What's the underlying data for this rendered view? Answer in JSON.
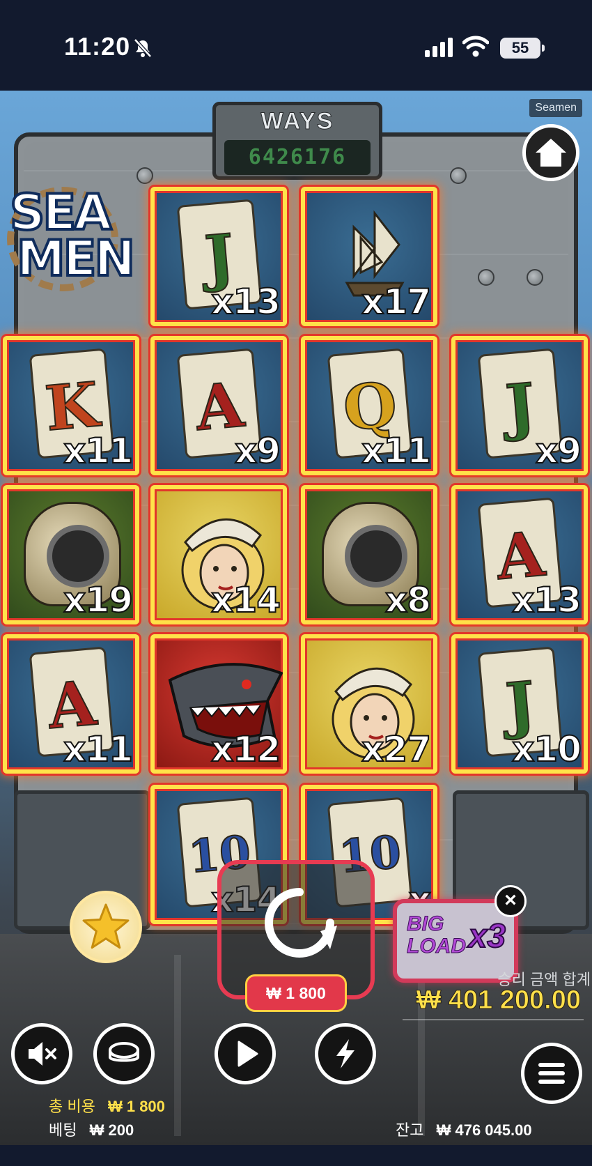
{
  "status_bar": {
    "time": "11:20",
    "battery": "55"
  },
  "game": {
    "name_label": "Seamen",
    "logo": {
      "line1": "SEA",
      "line2": "MEN"
    },
    "ways": {
      "label": "WAYS",
      "value": "6426176"
    }
  },
  "reels": [
    {
      "symbol": "J",
      "color": "#2f6b2a",
      "bg": "blue",
      "kind": "card",
      "multiplier": "x13"
    },
    {
      "symbol": "ship",
      "color": "#e8e2cc",
      "bg": "blue",
      "kind": "ship",
      "multiplier": "x17"
    },
    {
      "symbol": "K",
      "color": "#c0441e",
      "bg": "blue",
      "kind": "card",
      "multiplier": "x11"
    },
    {
      "symbol": "A",
      "color": "#a5211e",
      "bg": "blue",
      "kind": "card",
      "multiplier": "x9"
    },
    {
      "symbol": "Q",
      "color": "#d6a21e",
      "bg": "blue",
      "kind": "card",
      "multiplier": "x11"
    },
    {
      "symbol": "J",
      "color": "#2f6b2a",
      "bg": "blue",
      "kind": "card",
      "multiplier": "x9"
    },
    {
      "symbol": "diving-helmet",
      "color": "#8d7e55",
      "bg": "green",
      "kind": "helmet",
      "multiplier": "x19"
    },
    {
      "symbol": "sailor-girl",
      "color": "#f0d26a",
      "bg": "yellow",
      "kind": "sailor",
      "multiplier": "x14"
    },
    {
      "symbol": "diving-helmet",
      "color": "#8d7e55",
      "bg": "green",
      "kind": "helmet",
      "multiplier": "x8"
    },
    {
      "symbol": "A",
      "color": "#a5211e",
      "bg": "blue",
      "kind": "card",
      "multiplier": "x13"
    },
    {
      "symbol": "A",
      "color": "#a5211e",
      "bg": "blue",
      "kind": "card",
      "multiplier": "x11"
    },
    {
      "symbol": "shark",
      "color": "#4a4f56",
      "bg": "red",
      "kind": "shark",
      "multiplier": "x12"
    },
    {
      "symbol": "sailor-girl",
      "color": "#f0d26a",
      "bg": "yellow",
      "kind": "sailor",
      "multiplier": "x27"
    },
    {
      "symbol": "J",
      "color": "#2f6b2a",
      "bg": "blue",
      "kind": "card",
      "multiplier": "x10"
    },
    {
      "symbol": "10",
      "color": "#2a4fa0",
      "bg": "blue",
      "kind": "card",
      "multiplier": "x14"
    },
    {
      "symbol": "10",
      "color": "#2a4fa0",
      "bg": "blue",
      "kind": "card",
      "multiplier": "x"
    }
  ],
  "controls": {
    "spin_bet": "₩ 1 800",
    "big_load": {
      "line1": "BIG",
      "line2": "LOAD",
      "multiplier": "x3"
    },
    "close": "×",
    "win_label": "승리 금액 합계",
    "win_amount": "₩ 401 200.00"
  },
  "footer": {
    "total_cost_label": "총 비용",
    "total_cost_value": "₩ 1 800",
    "bet_label": "베팅",
    "bet_value": "₩ 200",
    "balance_label": "잔고",
    "balance_value": "₩ 476 045.00"
  }
}
